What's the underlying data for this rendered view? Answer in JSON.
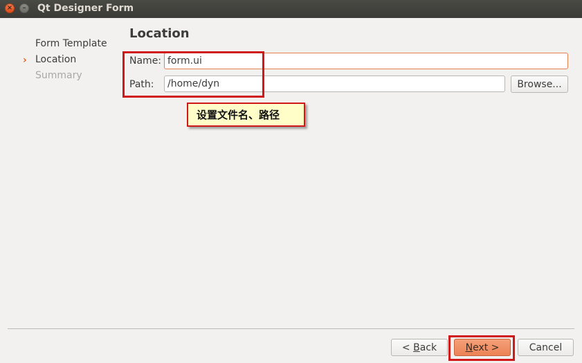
{
  "window": {
    "title": "Qt Designer Form",
    "close_glyph": "×",
    "minimize_glyph": "–"
  },
  "nav": {
    "steps": [
      {
        "label": "Form Template",
        "state": "done"
      },
      {
        "label": "Location",
        "state": "current"
      },
      {
        "label": "Summary",
        "state": "pending"
      }
    ],
    "current_marker": "›"
  },
  "page": {
    "title": "Location"
  },
  "form": {
    "name_label": "Name:",
    "name_value": "form.ui",
    "path_label": "Path:",
    "path_value": "/home/dyn",
    "browse_label": "Browse..."
  },
  "annotation": {
    "text": "设置文件名、路径"
  },
  "footer": {
    "back_prefix": "< ",
    "back_underlined": "B",
    "back_rest": "ack",
    "next_underlined": "N",
    "next_rest": "ext >",
    "cancel_label": "Cancel"
  },
  "colors": {
    "accent": "#e0601e",
    "highlight_box": "#d01818",
    "callout_bg": "#fffec8"
  }
}
